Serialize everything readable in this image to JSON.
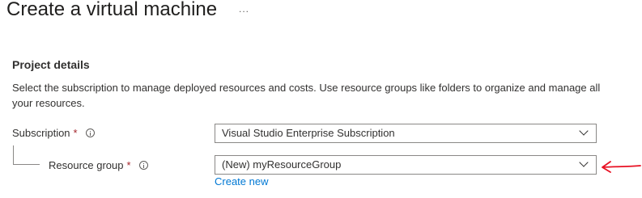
{
  "header": {
    "title": "Create a virtual machine",
    "more_label": "..."
  },
  "project_details": {
    "title": "Project details",
    "description": "Select the subscription to manage deployed resources and costs. Use resource groups like folders to organize and manage all your resources."
  },
  "subscription": {
    "label": "Subscription",
    "required_mark": "*",
    "value": "Visual Studio Enterprise Subscription"
  },
  "resource_group": {
    "label": "Resource group",
    "required_mark": "*",
    "value": "(New) myResourceGroup",
    "create_new_label": "Create new"
  },
  "colors": {
    "required": "#a4262c",
    "link": "#0078d4",
    "annotation_arrow": "#e81123"
  },
  "icons": {
    "info": "info-icon",
    "dropdown": "chevron-down-icon",
    "more": "more-icon",
    "annotation": "red-arrow-icon"
  }
}
